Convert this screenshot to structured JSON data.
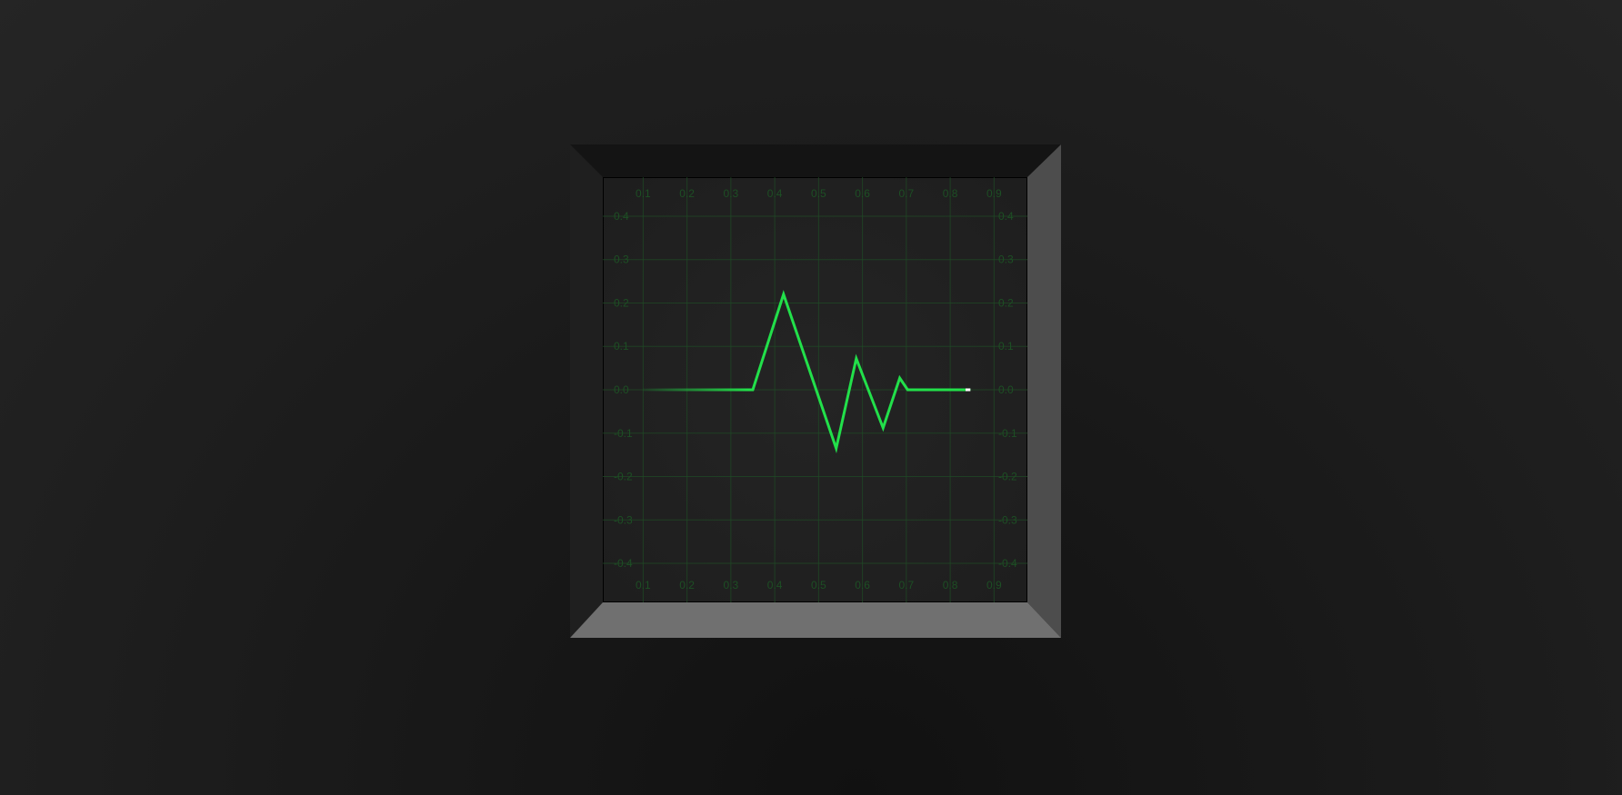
{
  "chart_data": {
    "type": "line",
    "title": "",
    "xlabel": "",
    "ylabel": "",
    "x_ticks": [
      "0.1",
      "0.2",
      "0.3",
      "0.4",
      "0.5",
      "0.6",
      "0.7",
      "0.8",
      "0.9"
    ],
    "y_ticks": [
      "0.4",
      "0.3",
      "0.2",
      "0.1",
      "0.0",
      "-0.1",
      "-0.2",
      "-0.3",
      "-0.4"
    ],
    "xlim": [
      0.008,
      0.976
    ],
    "ylim": [
      -0.49,
      0.49
    ],
    "grid": true,
    "series": [
      {
        "color": "#22e04a",
        "x": [
          0.1,
          0.35,
          0.42,
          0.54,
          0.586,
          0.647,
          0.685,
          0.703,
          0.835,
          0.846
        ],
        "y": [
          0.0,
          0.0,
          0.22,
          -0.135,
          0.072,
          -0.088,
          0.027,
          0.0,
          0.0,
          0.0
        ]
      }
    ]
  },
  "colors": {
    "background": "#1e1e1e",
    "screen": "#222222",
    "grid": "#1f4a25",
    "trace": "#22e04a",
    "trace_head": "#ffffff",
    "bezel_top": "#141414",
    "bezel_left": "#1f1f1f",
    "bezel_right": "#4d4d4d",
    "bezel_bottom": "#707070"
  }
}
